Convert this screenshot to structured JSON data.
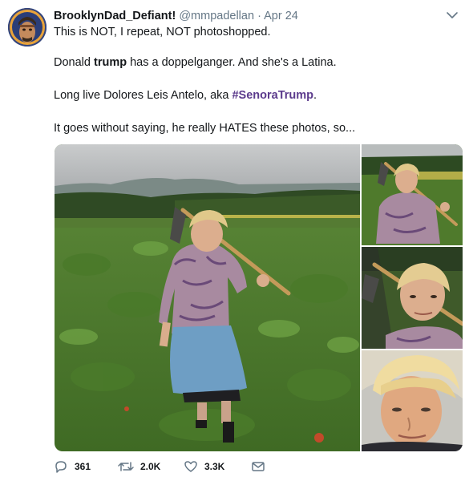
{
  "tweet": {
    "display_name": "BrooklynDad_Defiant!",
    "handle": "@mmpadellan",
    "separator": "·",
    "date": "Apr 24",
    "line1": "This is NOT, I repeat, NOT photoshopped.",
    "line2_pre": "Donald ",
    "line2_bold": "trump",
    "line2_post": " has a doppelganger. And she's a Latina.",
    "line3_pre": "Long live Dolores Leis Antelo, aka ",
    "line3_hashtag": "#SenoraTrump",
    "line3_post": ".",
    "line4": "It goes without saying, he really HATES these photos, so..."
  },
  "actions": {
    "reply_count": "361",
    "retweet_count": "2.0K",
    "like_count": "3.3K"
  },
  "icons": {
    "reply": "reply-icon",
    "retweet": "retweet-icon",
    "like": "heart-icon",
    "dm": "envelope-icon",
    "menu": "chevron-down-icon"
  },
  "colors": {
    "text": "#14171a",
    "muted": "#657786",
    "hashtag": "#5b3a8c"
  }
}
